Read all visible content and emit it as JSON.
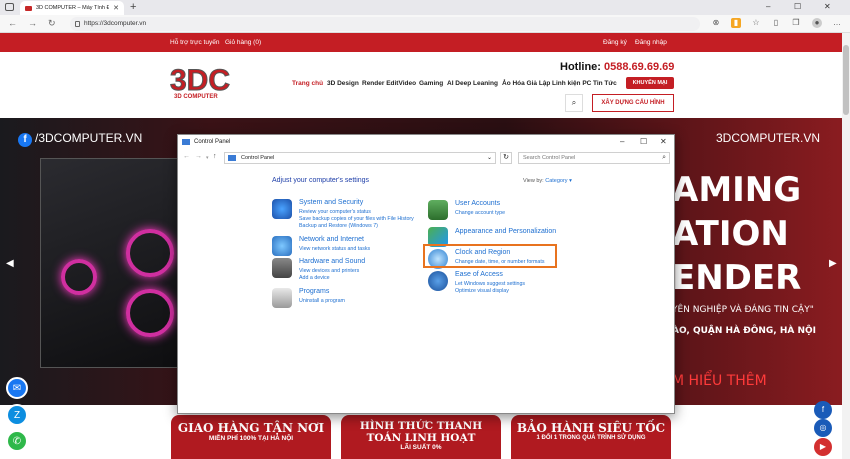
{
  "browser": {
    "tab_title": "3D COMPUTER – Máy Tính Đồ H",
    "tab_close": "✕",
    "new_tab": "+",
    "url": "https://3dcomputer.vn",
    "min": "–",
    "max": "☐",
    "close": "✕"
  },
  "site": {
    "topbar": {
      "support": "Hỗ trợ trực tuyến",
      "cart": "Giỏ hàng (0)",
      "register": "Đăng ký",
      "login": "Đăng nhập"
    },
    "hotline_label": "Hotline:",
    "hotline_number": "0588.69.69.69",
    "menu": [
      "Trang chủ",
      "3D Design",
      "Render EditVideo",
      "Gaming",
      "AI Deep Leaning",
      "Ảo Hóa Giả Lập",
      "Linh kiện PC",
      "Tin Tức"
    ],
    "promo": "KHUYẾN MẠI",
    "build_button": "XÂY DỰNG CẤU HÌNH",
    "hero": {
      "facebook": "/3DCOMPUTER.VN",
      "site_name": "3DCOMPUTER.VN",
      "line1": "AMING",
      "line2": "ATION",
      "line3": "ENDER",
      "tagline": "YÊN NGHIỆP VÀ ĐÁNG TIN CẬY\"",
      "address": "ÀO, QUẬN HÀ ĐÔNG, HÀ NỘI",
      "more": "M HIỂU THÊM"
    },
    "banners": [
      {
        "a": "GIAO HÀNG TẬN NƠI",
        "b": "MIỄN PHÍ 100% TẠI HÀ NỘI"
      },
      {
        "a": "HÌNH THỨC THANH TOÁN LINH HOẠT",
        "b": "LÃI SUẤT 0%"
      },
      {
        "a": "BẢO HÀNH SIÊU TỐC",
        "b": "1 ĐỔI 1 TRONG QUÁ TRÌNH SỬ DỤNG"
      }
    ]
  },
  "control_panel": {
    "title": "Control Panel",
    "breadcrumb": "Control Panel",
    "search_placeholder": "Search Control Panel",
    "heading": "Adjust your computer's settings",
    "view_by_label": "View by:",
    "view_by_value": "Category ▾",
    "categories": [
      {
        "title": "System and Security",
        "links": [
          "Review your computer's status",
          "Save backup copies of your files with File History",
          "Backup and Restore (Windows 7)"
        ]
      },
      {
        "title": "Network and Internet",
        "links": [
          "View network status and tasks"
        ]
      },
      {
        "title": "Hardware and Sound",
        "links": [
          "View devices and printers",
          "Add a device"
        ]
      },
      {
        "title": "Programs",
        "links": [
          "Uninstall a program"
        ]
      },
      {
        "title": "User Accounts",
        "links": [
          "Change account type"
        ]
      },
      {
        "title": "Appearance and Personalization",
        "links": []
      },
      {
        "title": "Clock and Region",
        "links": [
          "Change date, time, or number formats"
        ]
      },
      {
        "title": "Ease of Access",
        "links": [
          "Let Windows suggest settings",
          "Optimize visual display"
        ]
      }
    ]
  },
  "colors": {
    "brand_red": "#c41e24",
    "link_blue": "#1e6fd0",
    "highlight_orange": "#e8731f"
  }
}
